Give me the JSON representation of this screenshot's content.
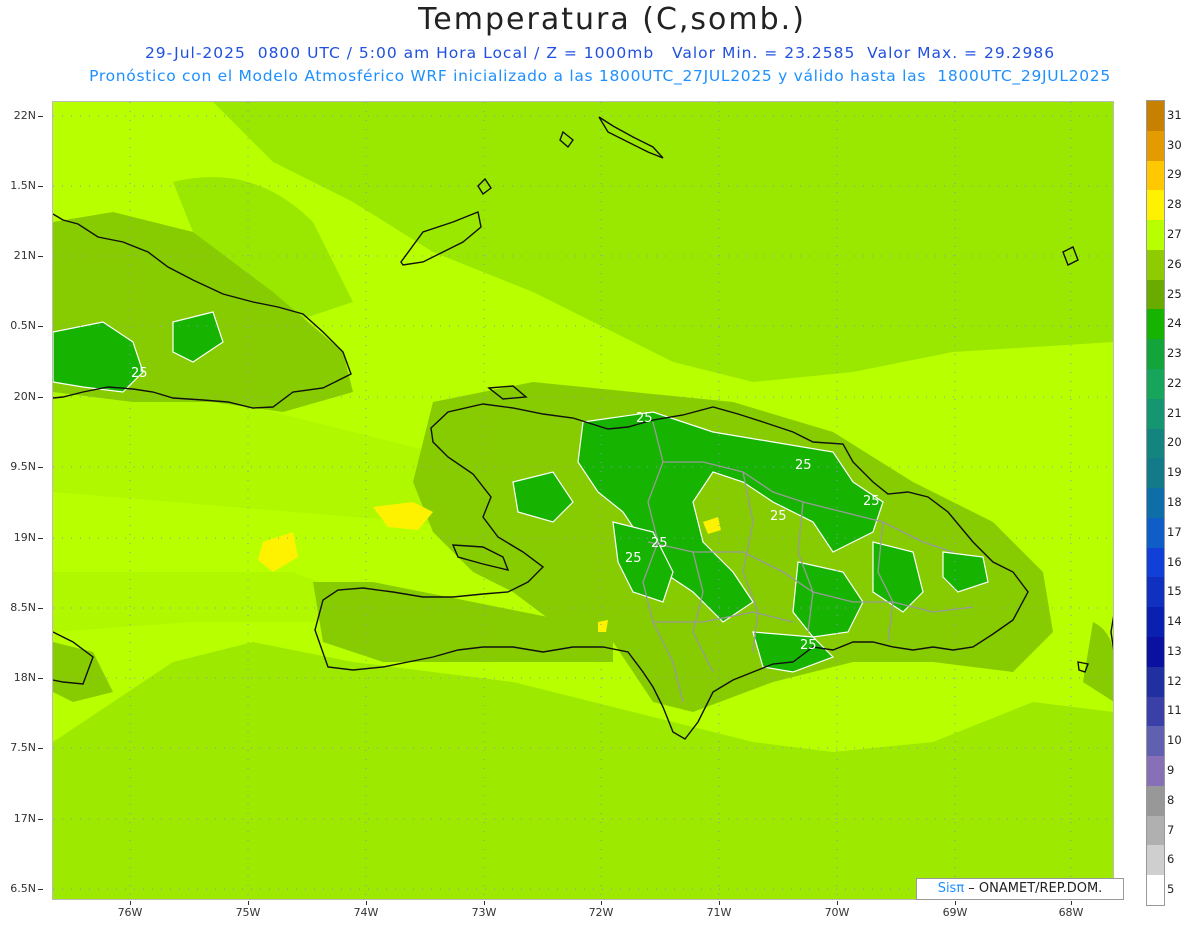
{
  "header": {
    "title": "Temperatura (C,somb.)",
    "subtitle1": "29-Jul-2025  0800 UTC / 5:00 am Hora Local / Z = 1000mb   Valor Min. = 23.2585  Valor Max. = 29.2986",
    "subtitle2": "Pronóstico con el Modelo Atmosférico WRF inicializado a las 1800UTC_27JUL2025 y válido hasta las  1800UTC_29JUL2025"
  },
  "axes": {
    "lat_labels": [
      "22N",
      "1.5N",
      "21N",
      "0.5N",
      "20N",
      "9.5N",
      "19N",
      "8.5N",
      "18N",
      "7.5N",
      "17N",
      "6.5N"
    ],
    "lon_labels": [
      "76W",
      "75W",
      "74W",
      "73W",
      "72W",
      "71W",
      "70W",
      "69W",
      "68W"
    ]
  },
  "colorbar": {
    "labels": [
      "31",
      "30",
      "29",
      "28",
      "27",
      "26",
      "25",
      "24",
      "23",
      "22",
      "21",
      "20",
      "19",
      "18",
      "17",
      "16",
      "15",
      "14",
      "13",
      "12",
      "11",
      "10",
      "9",
      "8",
      "7",
      "6",
      "5"
    ],
    "colors": [
      "#c88000",
      "#e39b00",
      "#ffc800",
      "#fff200",
      "#b8ff00",
      "#8ecb00",
      "#6aab00",
      "#16b400",
      "#14a53a",
      "#16a55a",
      "#159570",
      "#14857e",
      "#137a8a",
      "#0e6fa8",
      "#0f5ec8",
      "#1040d8",
      "#1030c0",
      "#0a20b0",
      "#0a10a0",
      "#2030a0",
      "#3a40a8",
      "#6060b0",
      "#8870b8",
      "#989898",
      "#b0b0b0",
      "#cfcfcf",
      "#ffffff"
    ]
  },
  "map": {
    "contour_labels": [
      "25",
      "25",
      "25",
      "25",
      "25",
      "25",
      "25",
      "25",
      "25"
    ],
    "colors": {
      "t27": "#b8ff00",
      "t26": "#97e000",
      "t25": "#7ec000",
      "t24": "#16b400",
      "t28": "#fff200",
      "coast": "#111111",
      "borders": "#999999",
      "grid": "#8f8fd0"
    }
  },
  "credit": {
    "brand": "Sisπ",
    "text": " – ONAMET/REP.DOM."
  }
}
